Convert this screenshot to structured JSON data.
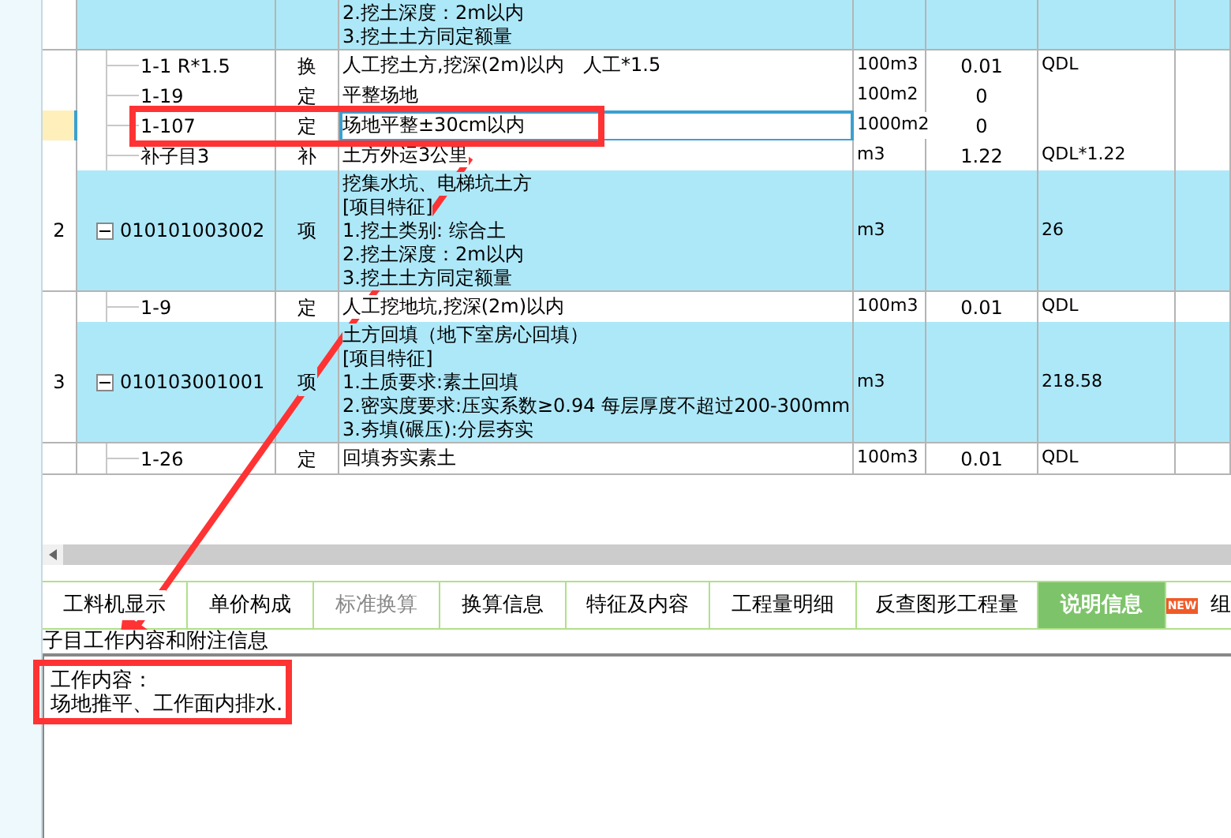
{
  "table": {
    "rows": [
      {
        "kind": "item",
        "name_lines": [
          "2.挖土深度：2m以内",
          "3.挖土土方同定额量"
        ],
        "selected": false
      },
      {
        "kind": "quota",
        "code": "1-1 R*1.5",
        "type": "换",
        "name_lines": [
          "人工挖土方,挖深(2m)以内　人工*1.5"
        ],
        "unit": "100m3",
        "quantity": "0.01",
        "expression": "QDL",
        "selected": false
      },
      {
        "kind": "quota",
        "code": "1-19",
        "type": "定",
        "name_lines": [
          "平整场地"
        ],
        "unit": "100m2",
        "quantity": "0",
        "selected": false
      },
      {
        "kind": "quota",
        "code": "1-107",
        "type": "定",
        "name_lines": [
          "场地平整±30cm以内"
        ],
        "unit": "1000m2",
        "quantity": "0",
        "selected": true
      },
      {
        "kind": "quota",
        "code": "补子目3",
        "type": "补",
        "name_lines": [
          "土方外运3公里"
        ],
        "unit": "m3",
        "quantity": "1.22",
        "expression": "QDL*1.22",
        "selected": false
      },
      {
        "kind": "item",
        "number": "2",
        "code": "010101003002",
        "expanded": true,
        "type": "项",
        "name_lines": [
          "挖集水坑、电梯坑土方",
          "[项目特征]",
          "1.挖土类别: 综合土",
          "2.挖土深度：2m以内",
          "3.挖土土方同定额量"
        ],
        "unit": "m3",
        "expression": "26",
        "selected": false
      },
      {
        "kind": "quota",
        "code": "1-9",
        "type": "定",
        "name_lines": [
          "人工挖地坑,挖深(2m)以内"
        ],
        "unit": "100m3",
        "quantity": "0.01",
        "expression": "QDL",
        "selected": false
      },
      {
        "kind": "item",
        "number": "3",
        "code": "010103001001",
        "expanded": true,
        "type": "项",
        "name_lines": [
          "土方回填（地下室房心回填）",
          "[项目特征]",
          "1.土质要求:素土回填",
          "2.密实度要求:压实系数≥0.94 每层厚度不超过200-300mm",
          "3.夯填(碾压):分层夯实"
        ],
        "unit": "m3",
        "expression": "218.58",
        "selected": false
      },
      {
        "kind": "quota",
        "code": "1-26",
        "type": "定",
        "name_lines": [
          "回填夯实素土"
        ],
        "unit": "100m3",
        "quantity": "0.01",
        "expression": "QDL",
        "selected": false
      }
    ]
  },
  "tabs": [
    {
      "label": "工料机显示",
      "selected": false,
      "disabled": false
    },
    {
      "label": "单价构成",
      "selected": false,
      "disabled": false
    },
    {
      "label": "标准换算",
      "selected": false,
      "disabled": true
    },
    {
      "label": "换算信息",
      "selected": false,
      "disabled": false
    },
    {
      "label": "特征及内容",
      "selected": false,
      "disabled": false
    },
    {
      "label": "工程量明细",
      "selected": false,
      "disabled": false
    },
    {
      "label": "反查图形工程量",
      "selected": false,
      "disabled": false
    },
    {
      "label": "说明信息",
      "selected": true,
      "disabled": false
    },
    {
      "label": "组",
      "badge": "NEW",
      "selected": false,
      "disabled": false
    }
  ],
  "info": {
    "title": "子目工作内容和附注信息",
    "lines": [
      "工作内容：",
      "场地推平、工作面内排水."
    ]
  }
}
